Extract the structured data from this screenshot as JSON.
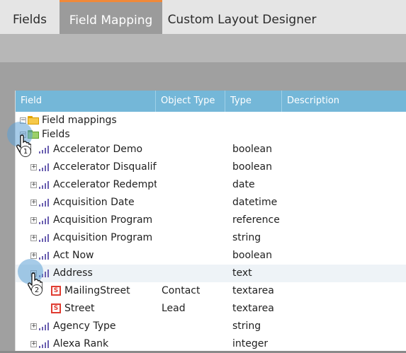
{
  "tabs": [
    {
      "label": "Fields"
    },
    {
      "label": "Field Mapping"
    },
    {
      "label": "Custom Layout Designer"
    }
  ],
  "grid": {
    "columns": {
      "field": "Field",
      "object_type": "Object Type",
      "type": "Type",
      "description": "Description"
    },
    "rows": [
      {
        "name": "Field mappings",
        "object_type": "",
        "type": ""
      },
      {
        "name": "Fields",
        "object_type": "",
        "type": ""
      },
      {
        "name": "Accelerator Demo",
        "object_type": "",
        "type": "boolean"
      },
      {
        "name": "Accelerator Disqualifie",
        "object_type": "",
        "type": "boolean"
      },
      {
        "name": "Accelerator Redempti",
        "object_type": "",
        "type": "date"
      },
      {
        "name": "Acquisition Date",
        "object_type": "",
        "type": "datetime"
      },
      {
        "name": "Acquisition Program",
        "object_type": "",
        "type": "reference"
      },
      {
        "name": "Acquisition Program N",
        "object_type": "",
        "type": "string"
      },
      {
        "name": "Act Now",
        "object_type": "",
        "type": "boolean"
      },
      {
        "name": "Address",
        "object_type": "",
        "type": "text"
      },
      {
        "name": "MailingStreet",
        "object_type": "Contact",
        "type": "textarea"
      },
      {
        "name": "Street",
        "object_type": "Lead",
        "type": "textarea"
      },
      {
        "name": "Agency Type",
        "object_type": "",
        "type": "string"
      },
      {
        "name": "Alexa Rank",
        "object_type": "",
        "type": "integer"
      }
    ]
  },
  "callouts": [
    {
      "number": "1"
    },
    {
      "number": "2"
    }
  ],
  "colors": {
    "active_tab_accent": "#f0893a",
    "header": "#74b7d8",
    "callout": "#5ca0d6"
  }
}
